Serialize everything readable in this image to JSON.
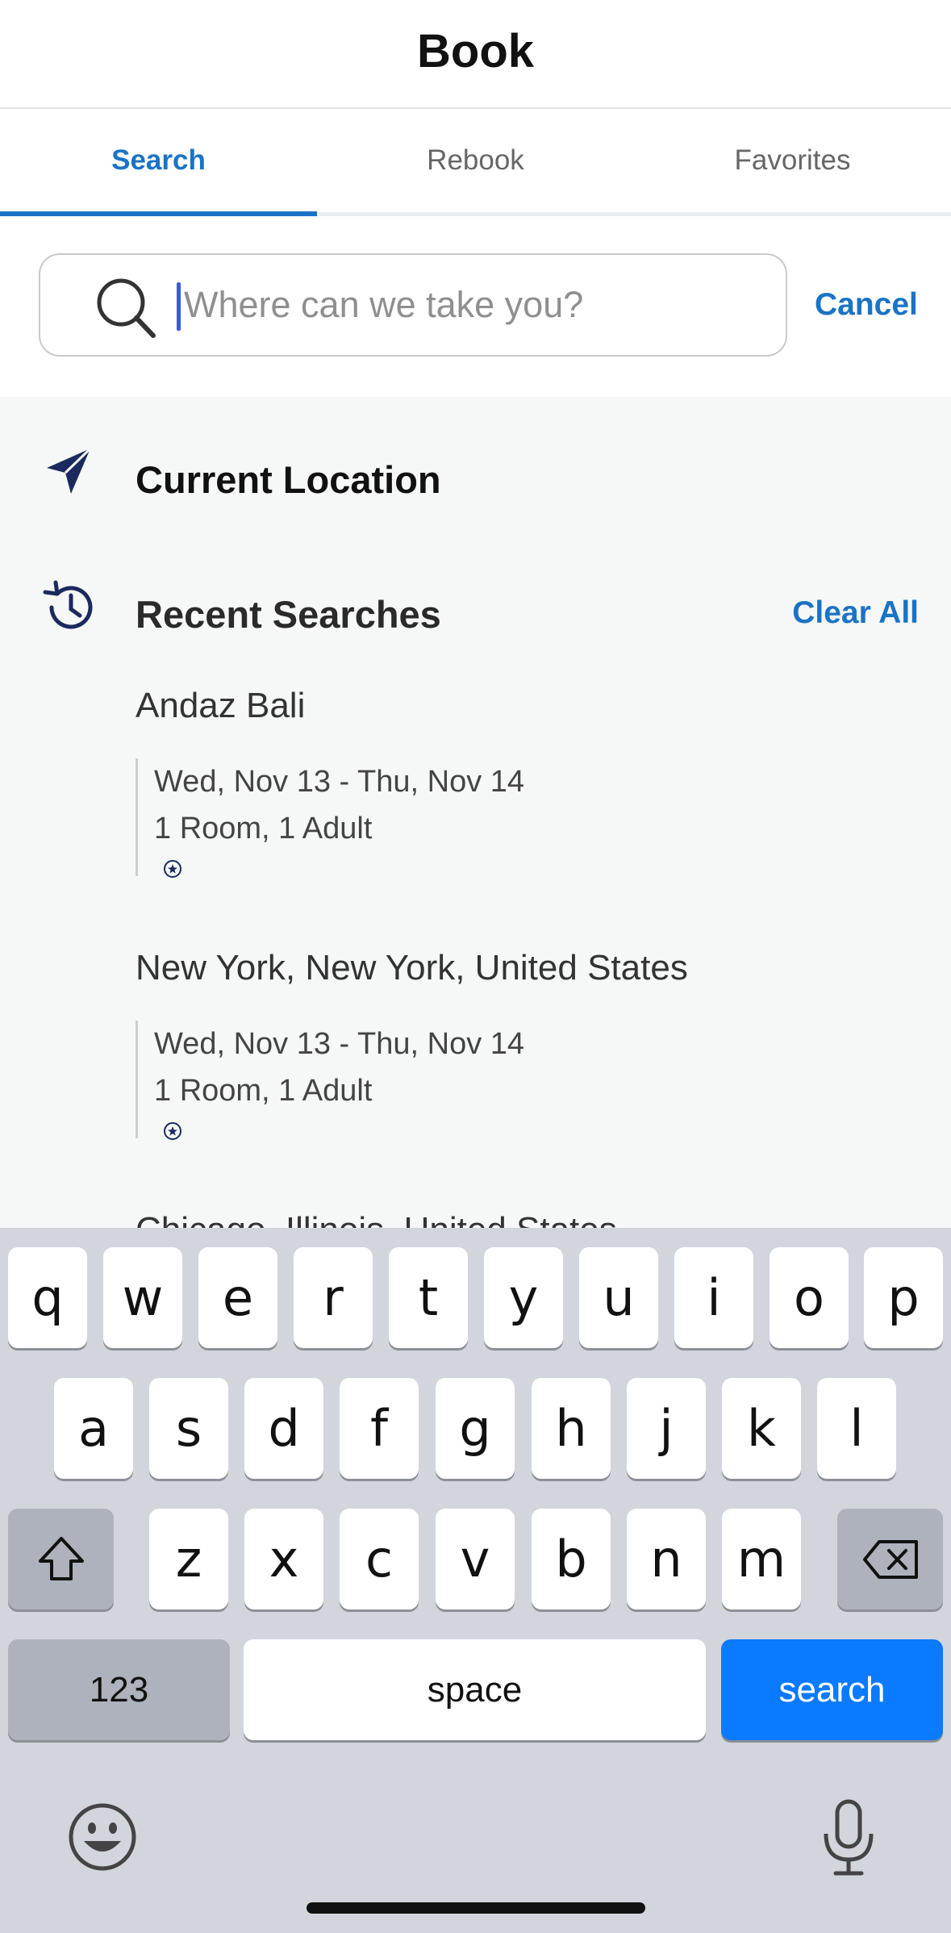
{
  "header": {
    "title": "Book"
  },
  "tabs": [
    {
      "label": "Search",
      "active": true
    },
    {
      "label": "Rebook",
      "active": false
    },
    {
      "label": "Favorites",
      "active": false
    }
  ],
  "search": {
    "placeholder": "Where can we take you?",
    "value": "",
    "cancel_label": "Cancel"
  },
  "current_location": {
    "label": "Current Location"
  },
  "recent": {
    "title": "Recent Searches",
    "clear_label": "Clear All",
    "items": [
      {
        "name": "Andaz Bali",
        "dates": "Wed, Nov 13 - Thu, Nov 14",
        "guests": "1 Room, 1 Adult"
      },
      {
        "name": "New York, New York, United States",
        "dates": "Wed, Nov 13 - Thu, Nov 14",
        "guests": "1 Room, 1 Adult"
      },
      {
        "name": "Chicago, Illinois, United States"
      }
    ]
  },
  "keyboard": {
    "row1": [
      "q",
      "w",
      "e",
      "r",
      "t",
      "y",
      "u",
      "i",
      "o",
      "p"
    ],
    "row2": [
      "a",
      "s",
      "d",
      "f",
      "g",
      "h",
      "j",
      "k",
      "l"
    ],
    "row3": [
      "z",
      "x",
      "c",
      "v",
      "b",
      "n",
      "m"
    ],
    "numbers_label": "123",
    "space_label": "space",
    "search_label": "search"
  },
  "colors": {
    "accent": "#1a73c6",
    "keyboard_bg": "#d2d5db",
    "search_key": "#0a7aff",
    "list_bg": "#f6f7f7"
  },
  "icons": {
    "search": "search-icon",
    "current_location": "navigation-arrow-icon",
    "recent": "history-icon",
    "badge": "star-badge-icon",
    "shift": "shift-icon",
    "delete": "backspace-icon",
    "emoji": "emoji-icon",
    "mic": "microphone-icon"
  }
}
